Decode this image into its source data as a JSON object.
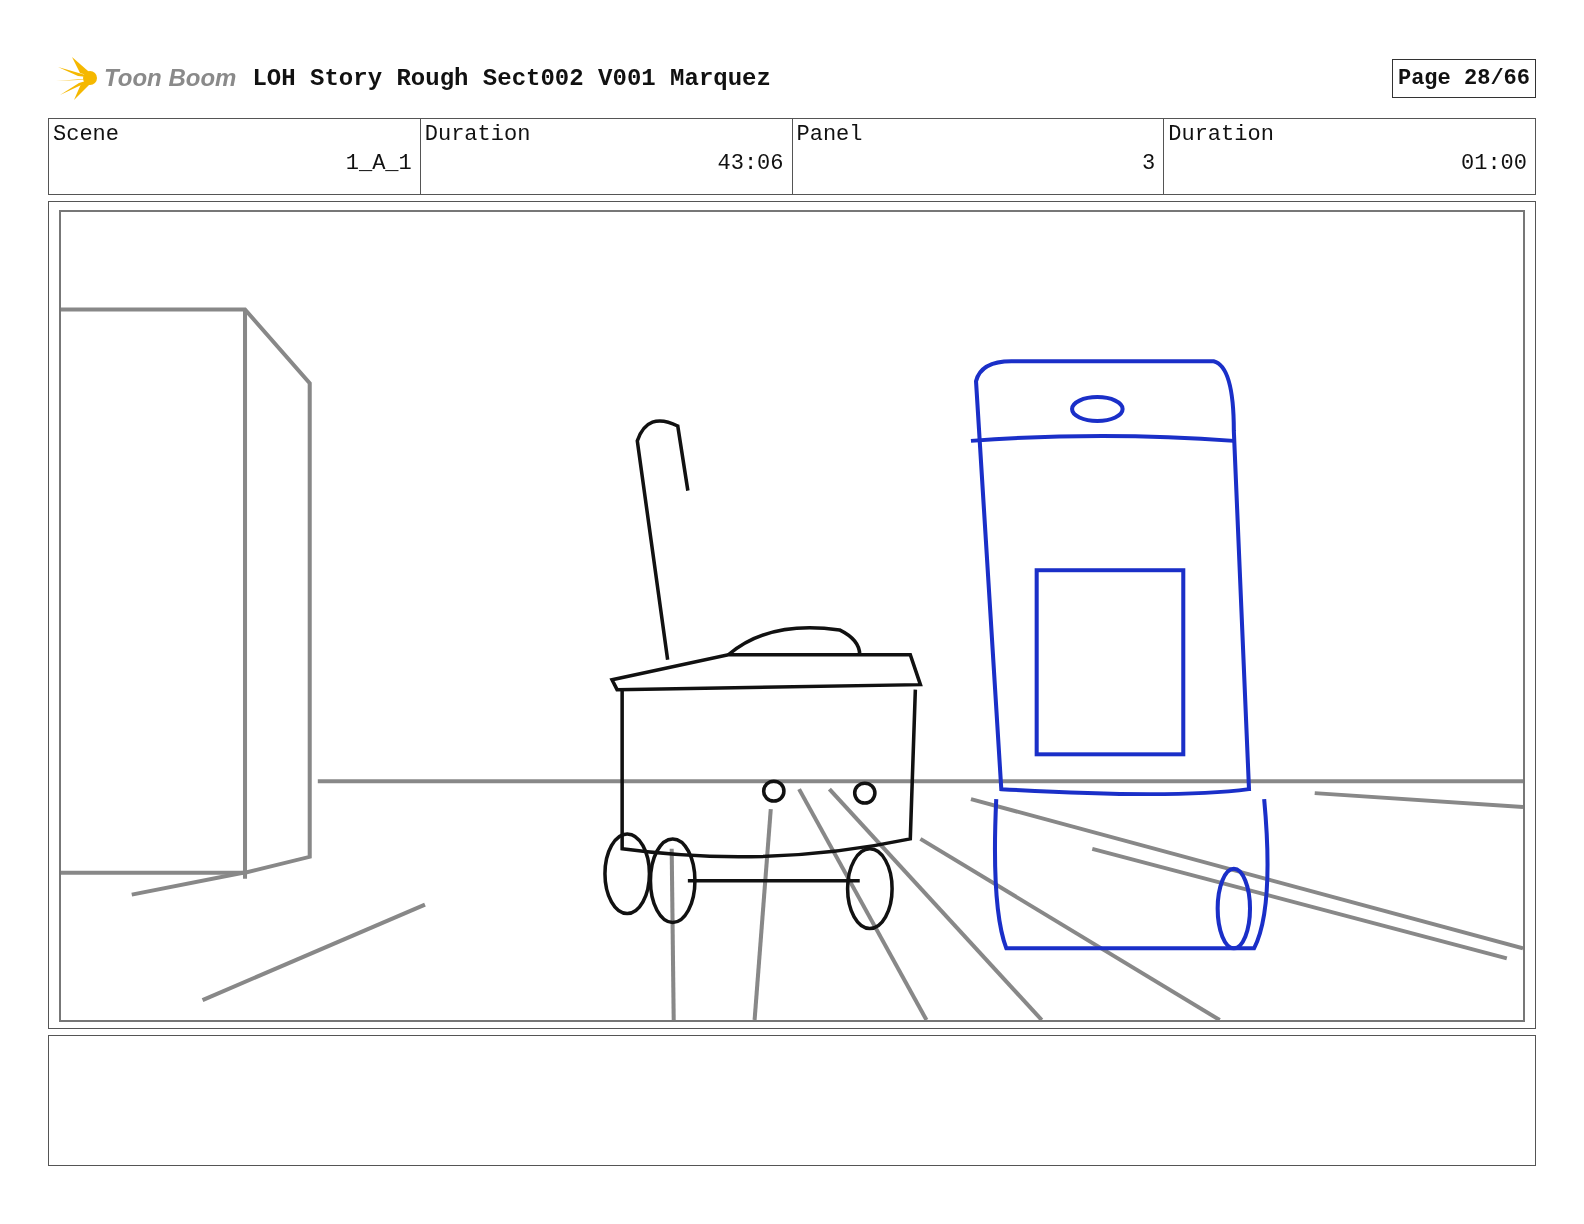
{
  "header": {
    "logo_text": "Toon Boom",
    "title": "LOH Story Rough Sect002 V001 Marquez",
    "page": "Page 28/66"
  },
  "info_table": {
    "headings": [
      "Scene",
      "Duration",
      "Panel",
      "Duration"
    ],
    "entries": [
      "1_A_1",
      "43:06",
      "3",
      "01:00"
    ]
  }
}
